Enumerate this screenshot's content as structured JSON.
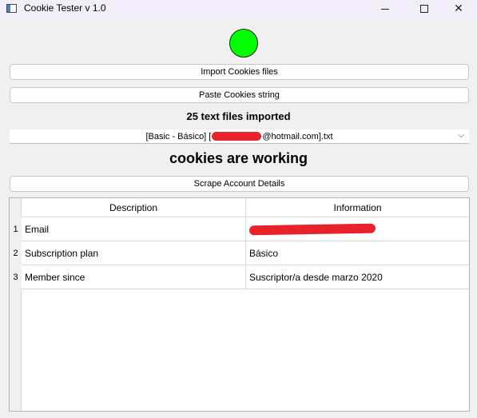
{
  "window": {
    "title": "Cookie Tester v 1.0",
    "minimize_icon": "minimize-icon",
    "maximize_icon": "maximize-icon",
    "close_glyph": "✕"
  },
  "status": {
    "indicator_color": "#00ff00"
  },
  "buttons": {
    "import_label": "Import Cookies files",
    "paste_label": "Paste Cookies string",
    "scrape_label": "Scrape Account Details"
  },
  "import_status": "25 text files imported",
  "file_select": {
    "prefix": "[Basic - Básico] [",
    "suffix": "@hotmail.com].txt",
    "chevron": "⌵"
  },
  "cookie_status": "cookies are working",
  "table": {
    "headers": [
      "Description",
      "Information"
    ],
    "rows": [
      {
        "num": "1",
        "description": "Email",
        "information": ""
      },
      {
        "num": "2",
        "description": "Subscription plan",
        "information": "Básico"
      },
      {
        "num": "3",
        "description": "Member since",
        "information": "Suscriptor/a desde marzo 2020"
      }
    ]
  }
}
